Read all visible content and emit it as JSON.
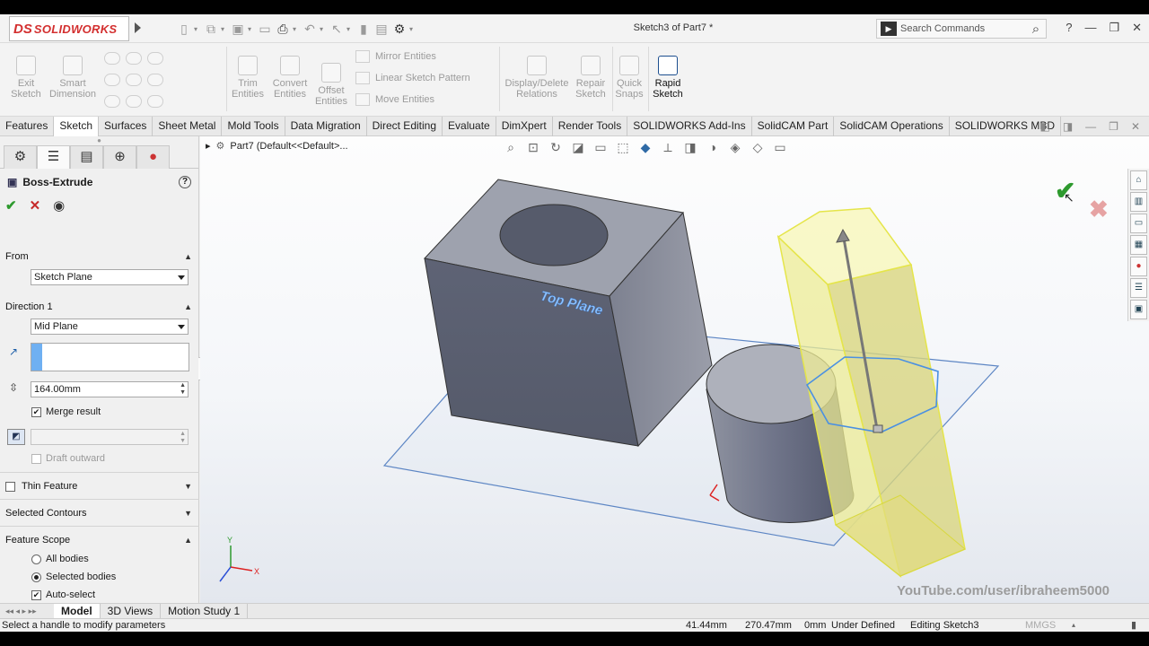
{
  "app": {
    "logo_ds": "DS",
    "logo_name": "SOLIDWORKS",
    "document_title": "Sketch3 of Part7 *",
    "search_placeholder": "Search Commands",
    "help_label": "?"
  },
  "ribbon": {
    "exit_sketch": [
      "Exit",
      "Sketch"
    ],
    "smart_dimension": [
      "Smart",
      "Dimension"
    ],
    "trim_entities": [
      "Trim",
      "Entities"
    ],
    "convert_entities": [
      "Convert",
      "Entities"
    ],
    "offset_entities": [
      "Offset",
      "Entities"
    ],
    "mirror_entities": "Mirror Entities",
    "linear_pattern": "Linear Sketch Pattern",
    "move_entities": "Move Entities",
    "display_delete": [
      "Display/Delete",
      "Relations"
    ],
    "repair_sketch": [
      "Repair",
      "Sketch"
    ],
    "quick_snaps": [
      "Quick",
      "Snaps"
    ],
    "rapid_sketch": [
      "Rapid",
      "Sketch"
    ]
  },
  "tabs": [
    "Features",
    "Sketch",
    "Surfaces",
    "Sheet Metal",
    "Mold Tools",
    "Data Migration",
    "Direct Editing",
    "Evaluate",
    "DimXpert",
    "Render Tools",
    "SOLIDWORKS Add-Ins",
    "SolidCAM Part",
    "SolidCAM Operations",
    "SOLIDWORKS MBD"
  ],
  "active_tab": "Sketch",
  "property_manager": {
    "title": "Boss-Extrude",
    "from_label": "From",
    "from_value": "Sketch Plane",
    "direction_label": "Direction 1",
    "direction_value": "Mid Plane",
    "depth_value": "164.00mm",
    "merge_result": "Merge result",
    "merge_checked": true,
    "draft_outward": "Draft outward",
    "thin_feature": "Thin Feature",
    "selected_contours": "Selected Contours",
    "feature_scope": "Feature Scope",
    "all_bodies": "All bodies",
    "selected_bodies": "Selected bodies",
    "auto_select": "Auto-select",
    "scope_selection": "Selected bodies",
    "auto_select_checked": true
  },
  "viewport": {
    "tree_crumb": "Part7  (Default<<Default>...",
    "plane_label": "Top Plane",
    "axis_x": "X",
    "axis_y": "Y",
    "watermark": "YouTube.com/user/ibraheem5000",
    "preview_color": "#f2ef9a",
    "body_color": "#6b7184",
    "sketch_color": "#3b7fd6"
  },
  "bottom_tabs": [
    "Model",
    "3D Views",
    "Motion Study 1"
  ],
  "active_bottom_tab": "Model",
  "status": {
    "message": "Select a handle to modify parameters",
    "x": "41.44mm",
    "y": "270.47mm",
    "z": "0mm",
    "state": "Under Defined",
    "editing": "Editing Sketch3",
    "units": "MMGS"
  }
}
